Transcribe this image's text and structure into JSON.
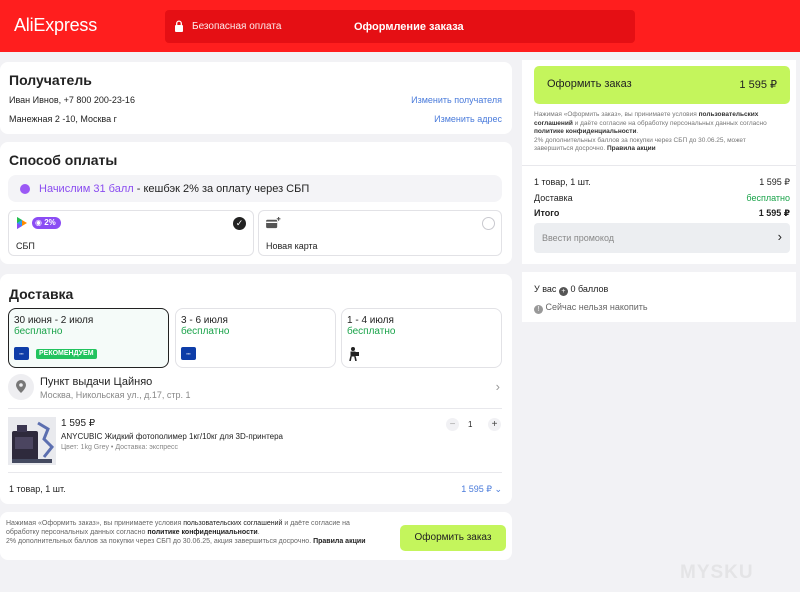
{
  "header": {
    "logo": "AliExpress",
    "secure_payment": "Безопасная оплата",
    "checkout_title": "Оформление заказа"
  },
  "recipient": {
    "title": "Получатель",
    "name_phone": "Иван Ивнов, +7 800 200-23-16",
    "address": "Манежная 2 -10, Москва г",
    "change_recipient": "Изменить получателя",
    "change_address": "Изменить адрес"
  },
  "payment": {
    "title": "Способ оплаты",
    "cashback_highlight": "Начислим 31 балл",
    "cashback_rest": " - кешбэк 2% за оплату через СБП",
    "options": [
      {
        "label": "СБП",
        "badge": "2%",
        "selected": true
      },
      {
        "label": "Новая карта",
        "selected": false
      }
    ]
  },
  "delivery": {
    "title": "Доставка",
    "options": [
      {
        "date": "30 июня - 2 июля",
        "price": "бесплатно",
        "badge": "РЕКОМЕНДУЕМ",
        "selected": true
      },
      {
        "date": "3 - 6 июля",
        "price": "бесплатно",
        "selected": false
      },
      {
        "date": "1 - 4 июля",
        "price": "бесплатно",
        "selected": false
      }
    ],
    "pickup_title": "Пункт выдачи Цайняо",
    "pickup_address": "Москва, Никольская ул., д.17, стр. 1"
  },
  "product": {
    "price": "1 595 ₽",
    "name": "ANYCUBIC Жидкий фотополимер 1кг/10кг для 3D-принтера",
    "variant": "Цвет: 1kg Grey • Доставка: экспресс",
    "quantity": "1",
    "minus": "−",
    "plus": "+"
  },
  "summary_row": {
    "count": "1 товар, 1 шт.",
    "total": "1 595 ₽"
  },
  "bottom": {
    "terms_1": "Нажимая «Оформить заказ», вы принимаете условия ",
    "terms_bold_1": "пользовательских соглашений",
    "terms_2": " и даёте согласие на обработку персональных данных согласно ",
    "terms_bold_2": "политике конфиденциальности",
    "terms_3": ".",
    "bonus_note": "2% дополнительных баллов за покупки через СБП до 30.06.25, акция завершиться досрочно. ",
    "bonus_link": "Правила акции",
    "button": "Оформить заказ"
  },
  "sidebar": {
    "order_button": "Оформить заказ",
    "order_total": "1 595 ₽",
    "terms_1": "Нажимая «Оформить заказ», вы принимаете условия ",
    "terms_bold_1": "пользовательских соглашений",
    "terms_2": " и даёте согласие на обработку персональных данных согласно ",
    "terms_bold_2": "политике конфиденциальности",
    "terms_3": ".",
    "bonus_note": "2% дополнительных баллов за покупки через СБП до 30.06.25, может завершиться досрочно. ",
    "bonus_link": "Правила акции",
    "items_label": "1 товар, 1 шт.",
    "items_value": "1 595 ₽",
    "delivery_label": "Доставка",
    "delivery_value": "бесплатно",
    "total_label": "Итого",
    "total_value": "1 595 ₽",
    "promo_placeholder": "Ввести промокод",
    "points_prefix": "У вас",
    "points_value": "0 баллов",
    "points_note": "Сейчас нельзя накопить"
  },
  "watermark": "MYSKU",
  "colors": {
    "brand_red": "#ff1e1e",
    "accent_green": "#c4f55c",
    "free_green": "#1aa34a",
    "link_blue": "#4a7bdb",
    "cashback_purple": "#8a4cf0"
  }
}
